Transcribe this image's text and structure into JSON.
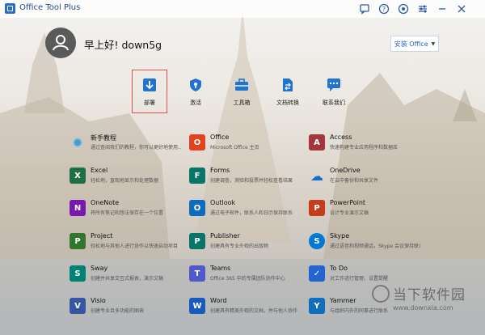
{
  "window": {
    "title": "Office Tool Plus"
  },
  "titlebar_icons": [
    "chat-icon",
    "help-icon",
    "settings-icon",
    "sliders-icon",
    "minimize-icon",
    "close-icon"
  ],
  "user": {
    "greeting": "早上好! down5g"
  },
  "install_button": {
    "label": "安装 Office"
  },
  "nav": [
    {
      "label": "部署",
      "icon": "deploy-icon",
      "selected": true
    },
    {
      "label": "激活",
      "icon": "key-shield-icon"
    },
    {
      "label": "工具箱",
      "icon": "toolbox-icon"
    },
    {
      "label": "文档转换",
      "icon": "doc-convert-icon"
    },
    {
      "label": "联系我们",
      "icon": "chat-icon"
    }
  ],
  "apps": [
    {
      "name": "新手教程",
      "desc": "通过查阅我们的教程，你可以更好地使用...",
      "icon": "tutorial-icon",
      "color": "#3a9ee0",
      "glyph": "✹"
    },
    {
      "name": "Office",
      "desc": "Microsoft Office 主页",
      "icon": "office-icon",
      "color": "#e0431f",
      "glyph": "O"
    },
    {
      "name": "Access",
      "desc": "快速构建专业应用程序和数据库",
      "icon": "access-icon",
      "color": "#a4373a",
      "glyph": "A"
    },
    {
      "name": "Excel",
      "desc": "轻松地，直观地显示和处理数据",
      "icon": "excel-icon",
      "color": "#1d7044",
      "glyph": "X"
    },
    {
      "name": "Forms",
      "desc": "创建调查，测验和投票并轻松查看结果",
      "icon": "forms-icon",
      "color": "#077568",
      "glyph": "F"
    },
    {
      "name": "OneDrive",
      "desc": "在云中备份和共享文件",
      "icon": "onedrive-icon",
      "color": "#0e6fd1",
      "glyph": "☁"
    },
    {
      "name": "OneNote",
      "desc": "将所有笔记和想法保存在一个位置",
      "icon": "onenote-icon",
      "color": "#7719aa",
      "glyph": "N"
    },
    {
      "name": "Outlook",
      "desc": "通过电子邮件，联系人和日历保持联系",
      "icon": "outlook-icon",
      "color": "#0f6cbd",
      "glyph": "O"
    },
    {
      "name": "PowerPoint",
      "desc": "设计专业演示文稿",
      "icon": "powerpoint-icon",
      "color": "#c43e1c",
      "glyph": "P"
    },
    {
      "name": "Project",
      "desc": "轻松地与其他人进行协作以快速启动项目",
      "icon": "project-icon",
      "color": "#31752f",
      "glyph": "P"
    },
    {
      "name": "Publisher",
      "desc": "创建具有专业外观的出版物",
      "icon": "publisher-icon",
      "color": "#077568",
      "glyph": "P"
    },
    {
      "name": "Skype",
      "desc": "通过语音和视频通话，Skype 会议保持联系",
      "icon": "skype-icon",
      "color": "#0078d4",
      "glyph": "S"
    },
    {
      "name": "Sway",
      "desc": "创建并共享交互式报表，演示文稿",
      "icon": "sway-icon",
      "color": "#008272",
      "glyph": "S"
    },
    {
      "name": "Teams",
      "desc": "Office 365 中的专属团队协作中心",
      "icon": "teams-icon",
      "color": "#5059c9",
      "glyph": "T"
    },
    {
      "name": "To Do",
      "desc": "对工作进行管理，设置提醒",
      "icon": "todo-icon",
      "color": "#2564cf",
      "glyph": "✓"
    },
    {
      "name": "Visio",
      "desc": "创建专业且多功能的图表",
      "icon": "visio-icon",
      "color": "#3955a3",
      "glyph": "V"
    },
    {
      "name": "Word",
      "desc": "创建具有精美外观的文档，并与他人协作",
      "icon": "word-icon",
      "color": "#185abd",
      "glyph": "W"
    },
    {
      "name": "Yammer",
      "desc": "与组织内外的同事进行联系",
      "icon": "yammer-icon",
      "color": "#106ebe",
      "glyph": "Y"
    }
  ],
  "watermark": {
    "text": "当下软件园",
    "url": "www.downxia.com"
  }
}
